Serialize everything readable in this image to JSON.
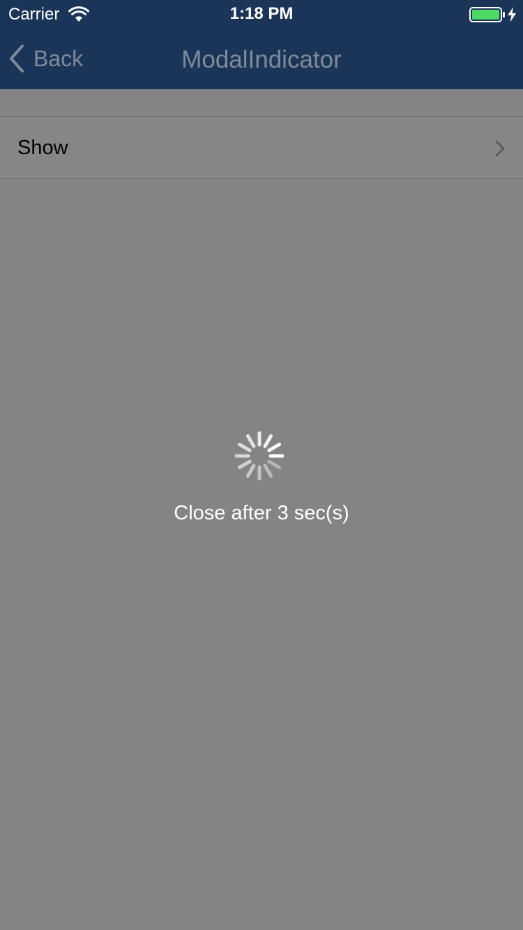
{
  "status_bar": {
    "carrier": "Carrier",
    "time": "1:18 PM",
    "battery_level": 1.0,
    "icons": [
      "wifi-icon",
      "battery-icon",
      "charging-bolt-icon"
    ]
  },
  "nav_bar": {
    "back_label": "Back",
    "title": "ModalIndicator",
    "background_color": "#1b3559",
    "text_color": "#7f8a99"
  },
  "table": {
    "rows": [
      {
        "label": "Show",
        "accessory": "chevron-right-icon"
      }
    ]
  },
  "hud": {
    "indicator": "activity-spinner-icon",
    "message": "Close after 3 sec(s)"
  },
  "colors": {
    "dim_overlay": "#848484",
    "battery_fill": "#4cd964"
  }
}
